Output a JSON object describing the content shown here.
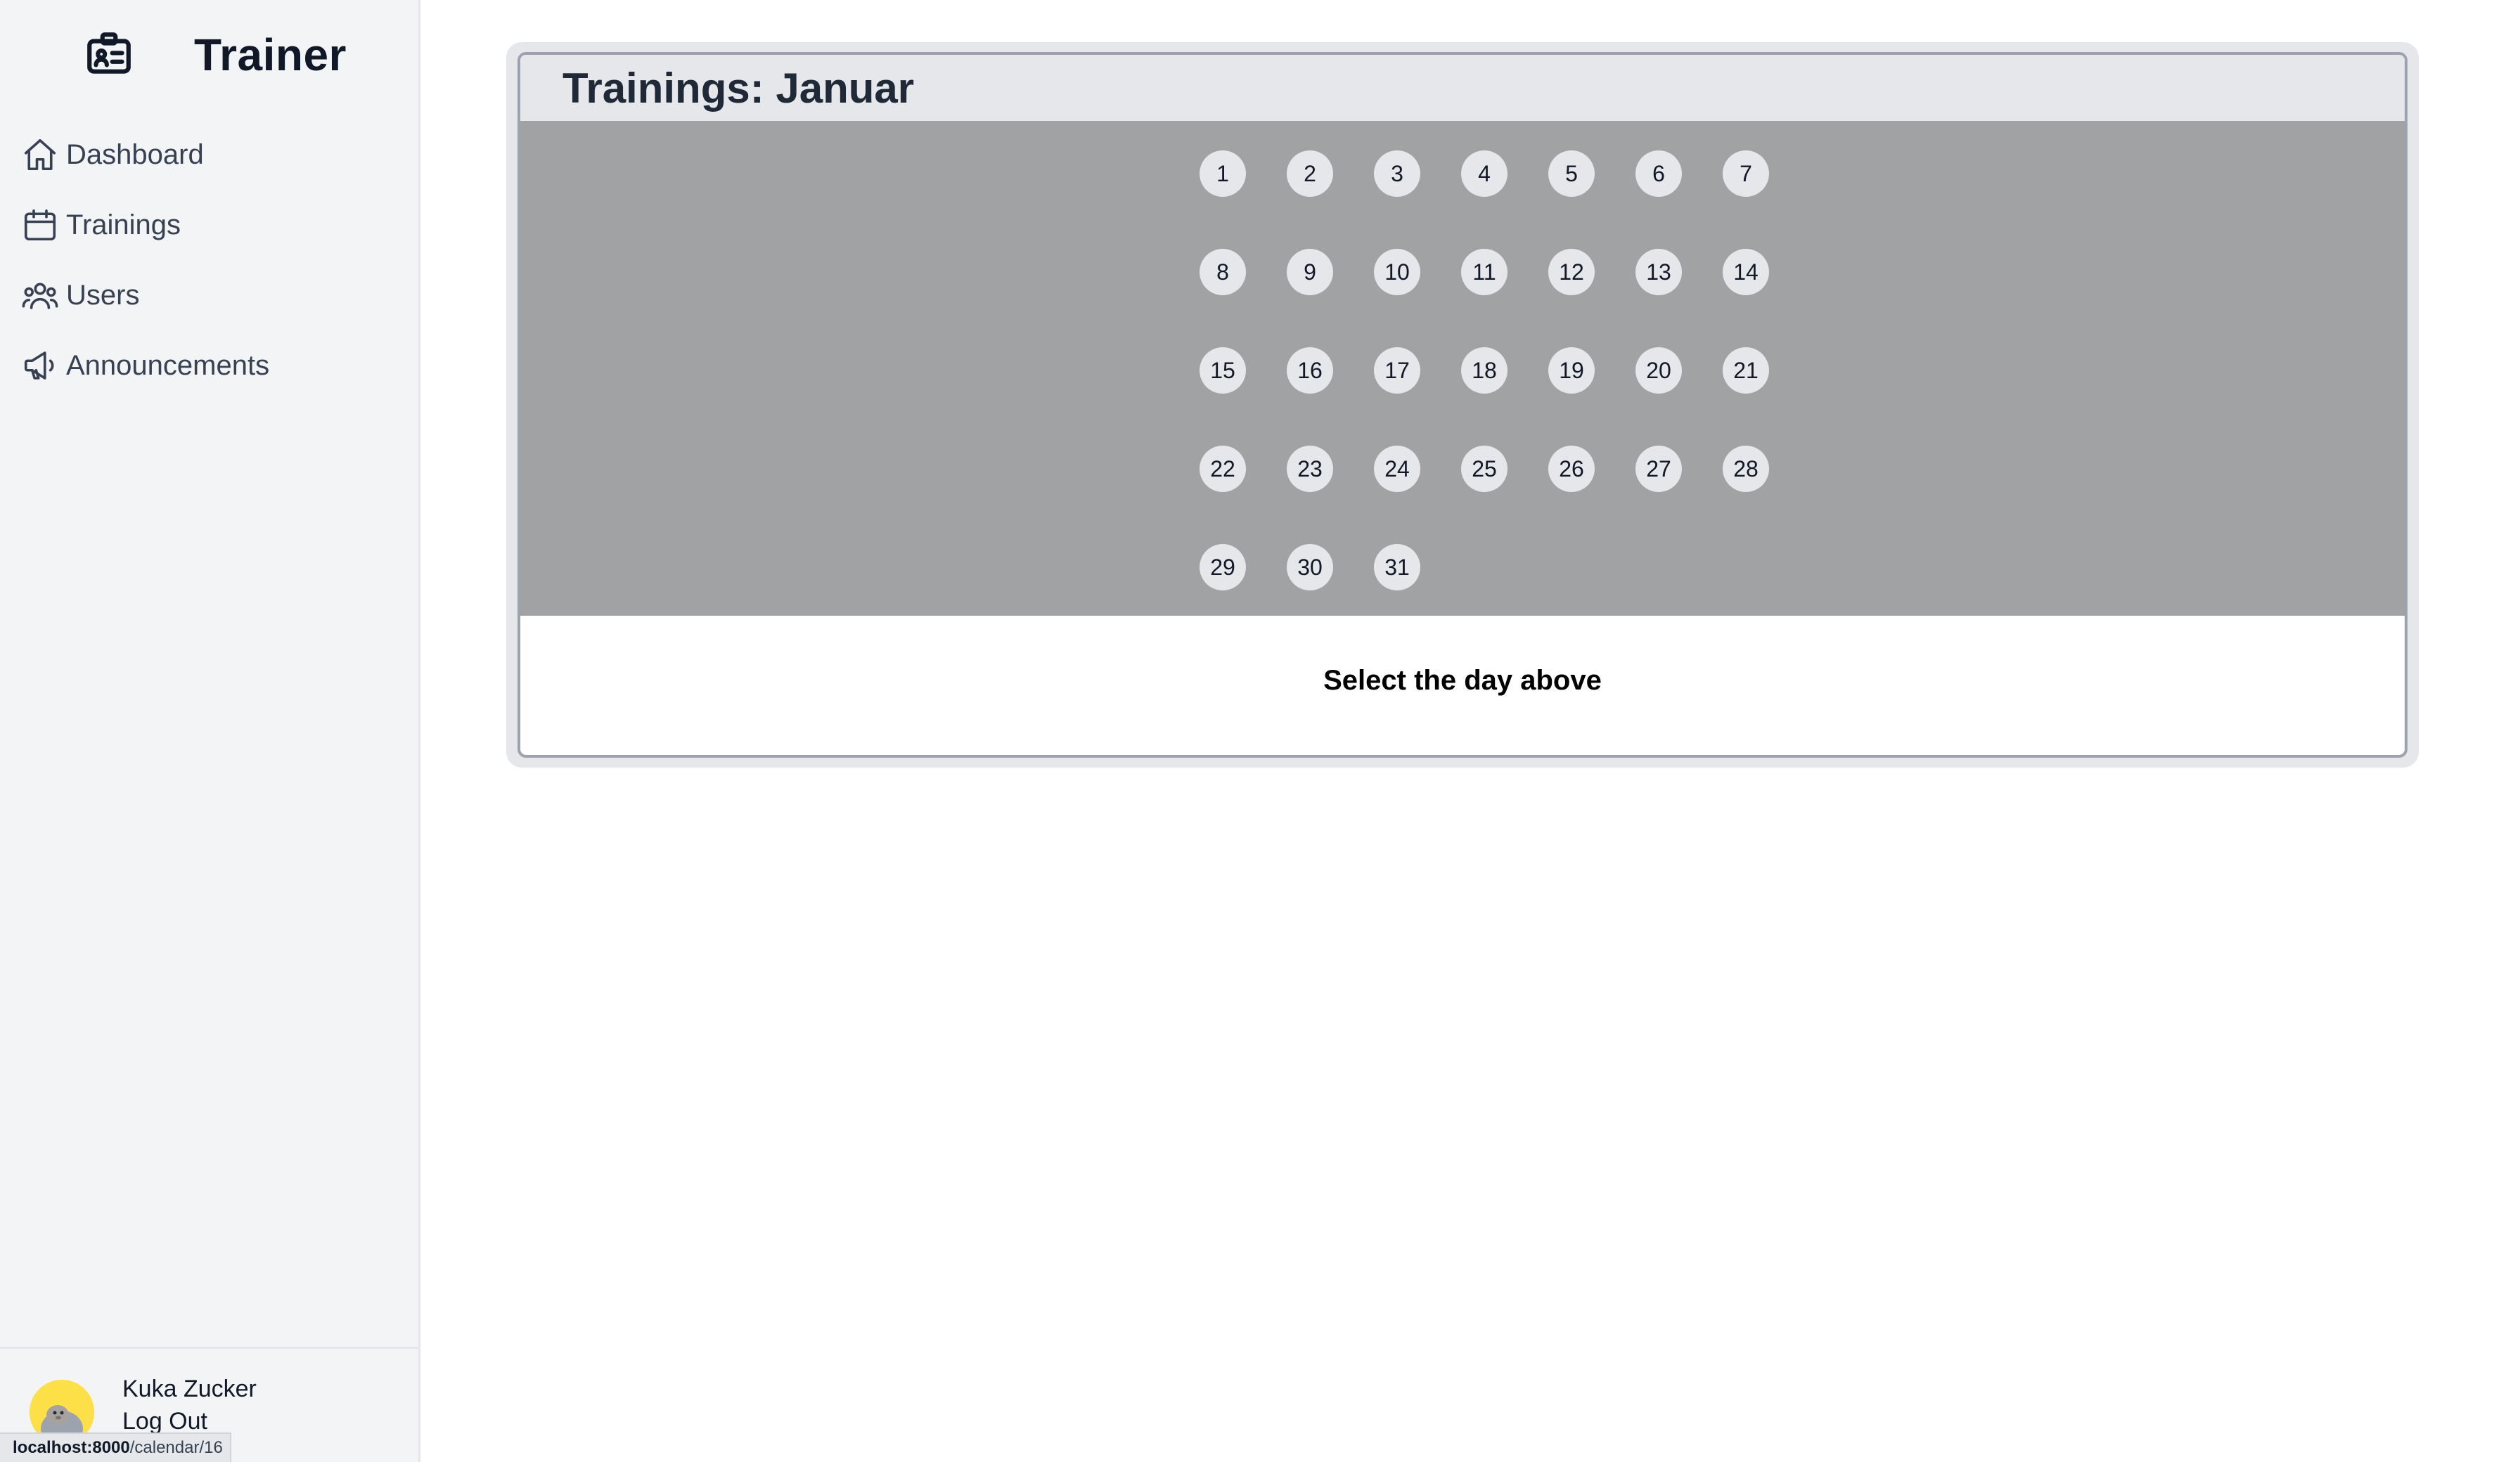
{
  "sidebar": {
    "brand": "Trainer",
    "items": [
      {
        "label": "Dashboard",
        "icon": "home-icon"
      },
      {
        "label": "Trainings",
        "icon": "calendar-icon"
      },
      {
        "label": "Users",
        "icon": "users-icon"
      },
      {
        "label": "Announcements",
        "icon": "megaphone-icon"
      }
    ],
    "user": {
      "name": "Kuka Zucker",
      "logout": "Log Out"
    }
  },
  "status_bar": {
    "host": "localhost:8000",
    "path": "/calendar/16"
  },
  "main": {
    "title": "Trainings: Januar",
    "days": [
      "1",
      "2",
      "3",
      "4",
      "5",
      "6",
      "7",
      "8",
      "9",
      "10",
      "11",
      "12",
      "13",
      "14",
      "15",
      "16",
      "17",
      "18",
      "19",
      "20",
      "21",
      "22",
      "23",
      "24",
      "25",
      "26",
      "27",
      "28",
      "29",
      "30",
      "31"
    ],
    "hint": "Select the day above"
  },
  "colors": {
    "sidebar_bg": "#f3f4f6",
    "days_panel_bg": "#a1a2a4",
    "day_bg": "#e5e7eb",
    "header_bg": "#e5e7eb"
  }
}
